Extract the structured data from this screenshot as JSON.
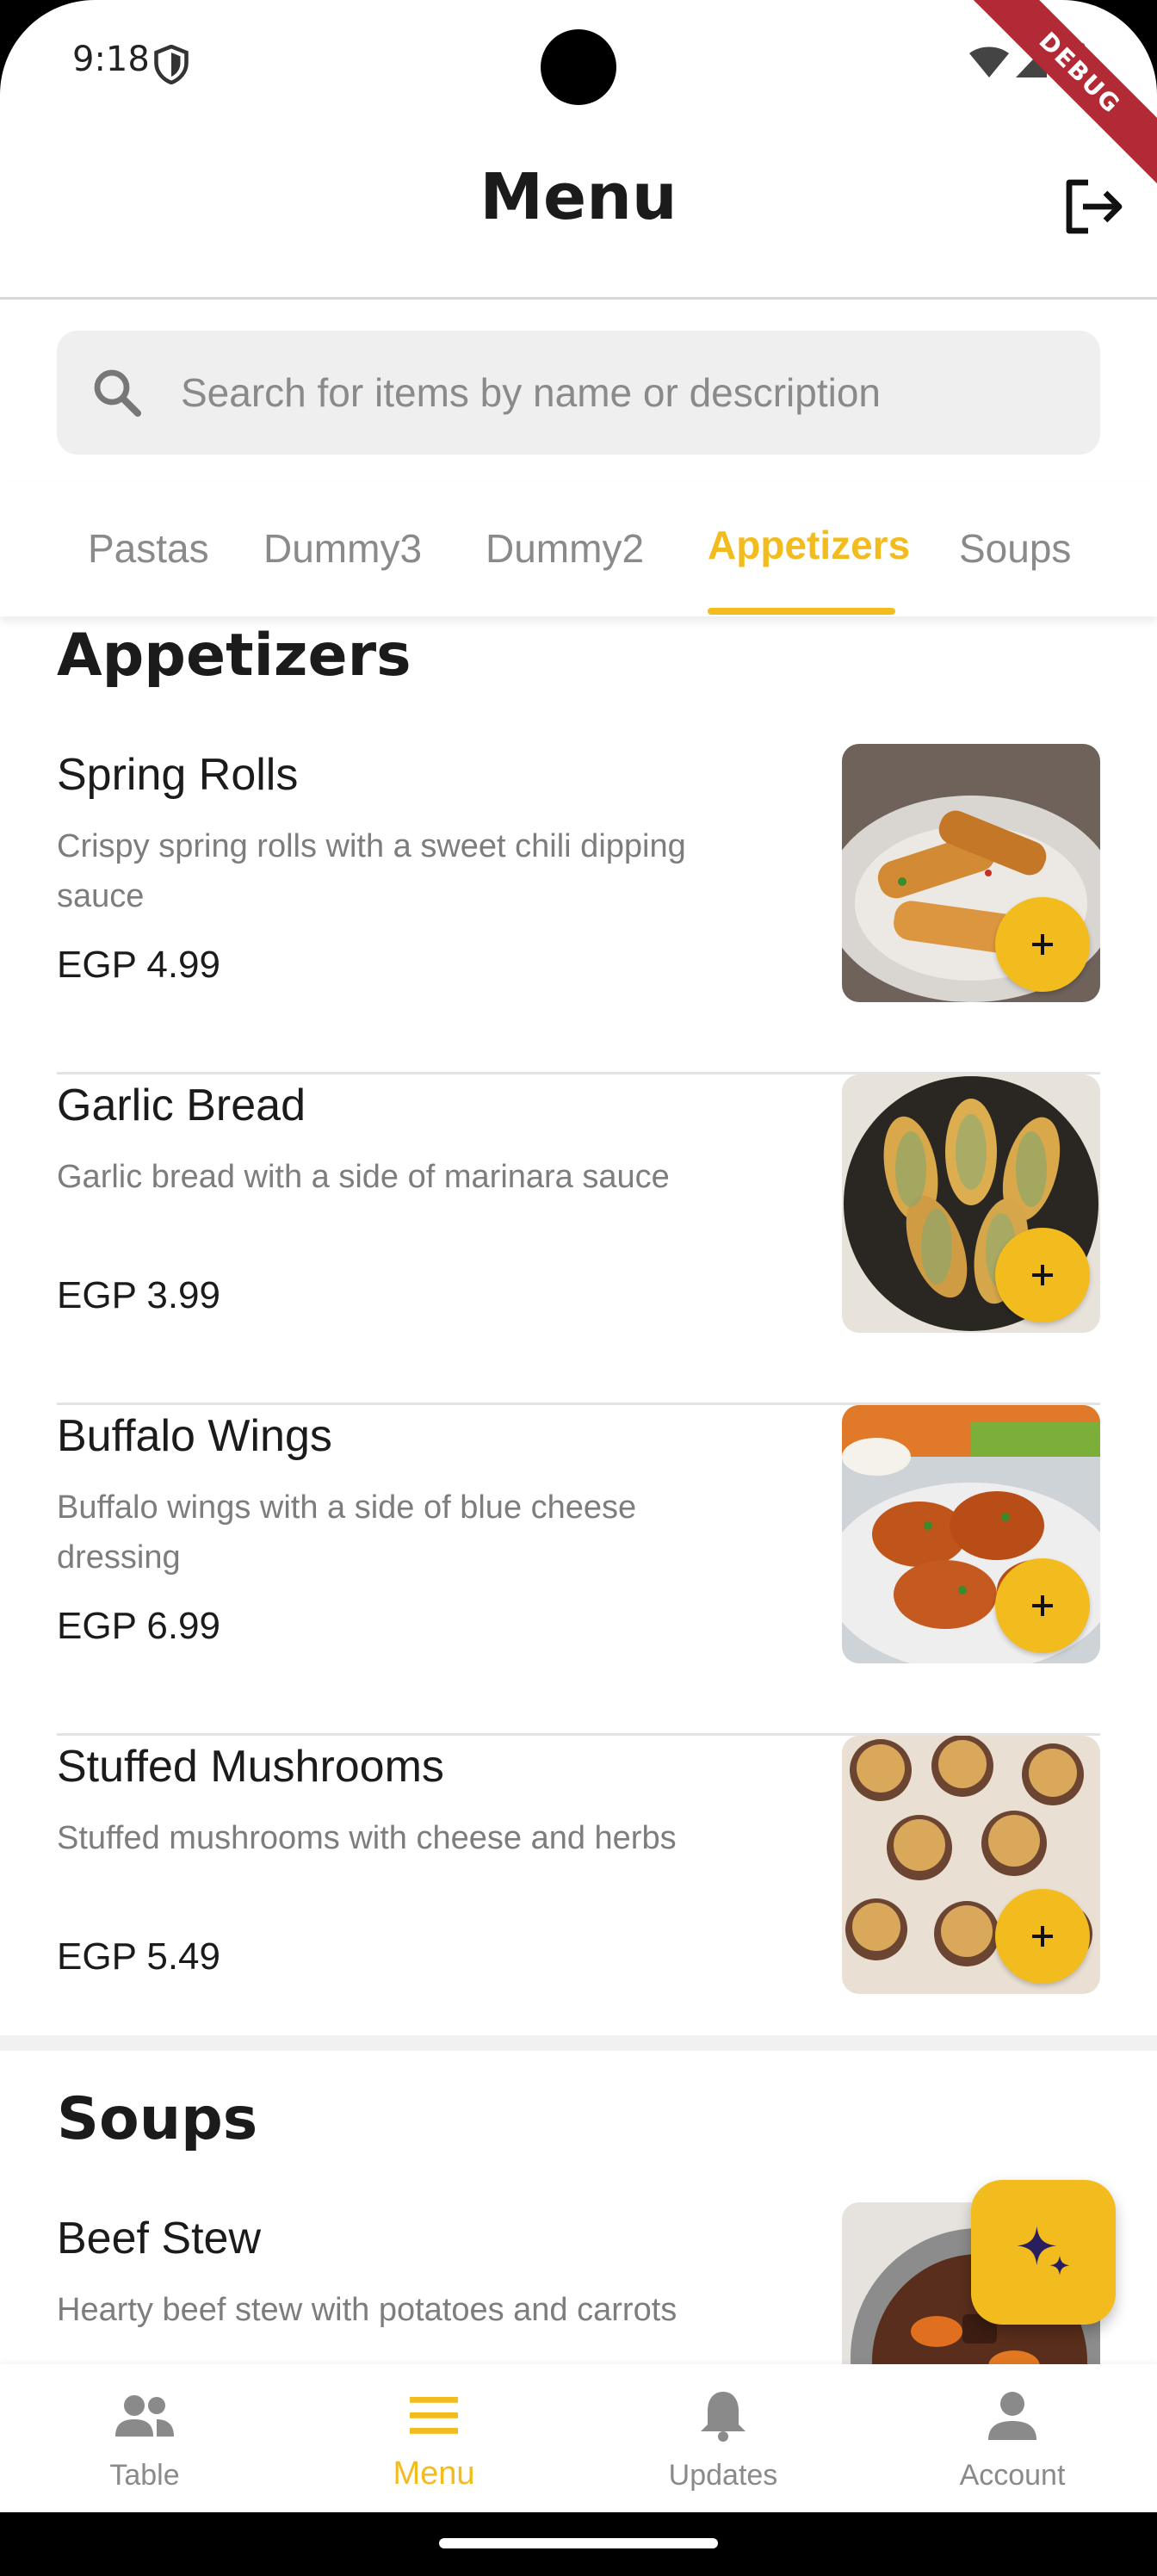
{
  "status_bar": {
    "time": "9:18",
    "debug_label": "DEBUG"
  },
  "header": {
    "title": "Menu"
  },
  "search": {
    "placeholder": "Search for items by name or description",
    "value": ""
  },
  "tabs": [
    {
      "label": "Pastas"
    },
    {
      "label": "Dummy3"
    },
    {
      "label": "Dummy2"
    },
    {
      "label": "Appetizers"
    },
    {
      "label": "Soups"
    }
  ],
  "sections": [
    {
      "title": "Appetizers",
      "items": [
        {
          "name": "Spring Rolls",
          "description": "Crispy spring rolls with a sweet chili dipping sauce",
          "price": "EGP 4.99"
        },
        {
          "name": "Garlic Bread",
          "description": "Garlic bread with a side of marinara sauce",
          "price": "EGP 3.99"
        },
        {
          "name": "Buffalo Wings",
          "description": "Buffalo wings with a side of blue cheese dressing",
          "price": "EGP 6.99"
        },
        {
          "name": "Stuffed Mushrooms",
          "description": "Stuffed mushrooms with cheese and herbs",
          "price": "EGP 5.49"
        }
      ]
    },
    {
      "title": "Soups",
      "items": [
        {
          "name": "Beef Stew",
          "description": "Hearty beef stew with potatoes and carrots",
          "price": ""
        }
      ]
    }
  ],
  "bottom_nav": [
    {
      "label": "Table",
      "icon": "people-icon"
    },
    {
      "label": "Menu",
      "icon": "menu-icon"
    },
    {
      "label": "Updates",
      "icon": "bell-icon"
    },
    {
      "label": "Account",
      "icon": "person-icon"
    }
  ],
  "colors": {
    "accent": "#f3bc1e",
    "text": "#1b1b1b",
    "muted": "#8a8a8a",
    "debug": "#b22a36"
  }
}
